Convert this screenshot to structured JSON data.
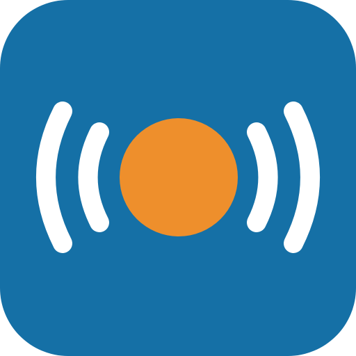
{
  "icon": {
    "name": "broadcast-signal-app-icon",
    "colors": {
      "background": "#1570A6",
      "waves": "#FFFFFF",
      "center_dot": "#EE8F2C"
    }
  }
}
